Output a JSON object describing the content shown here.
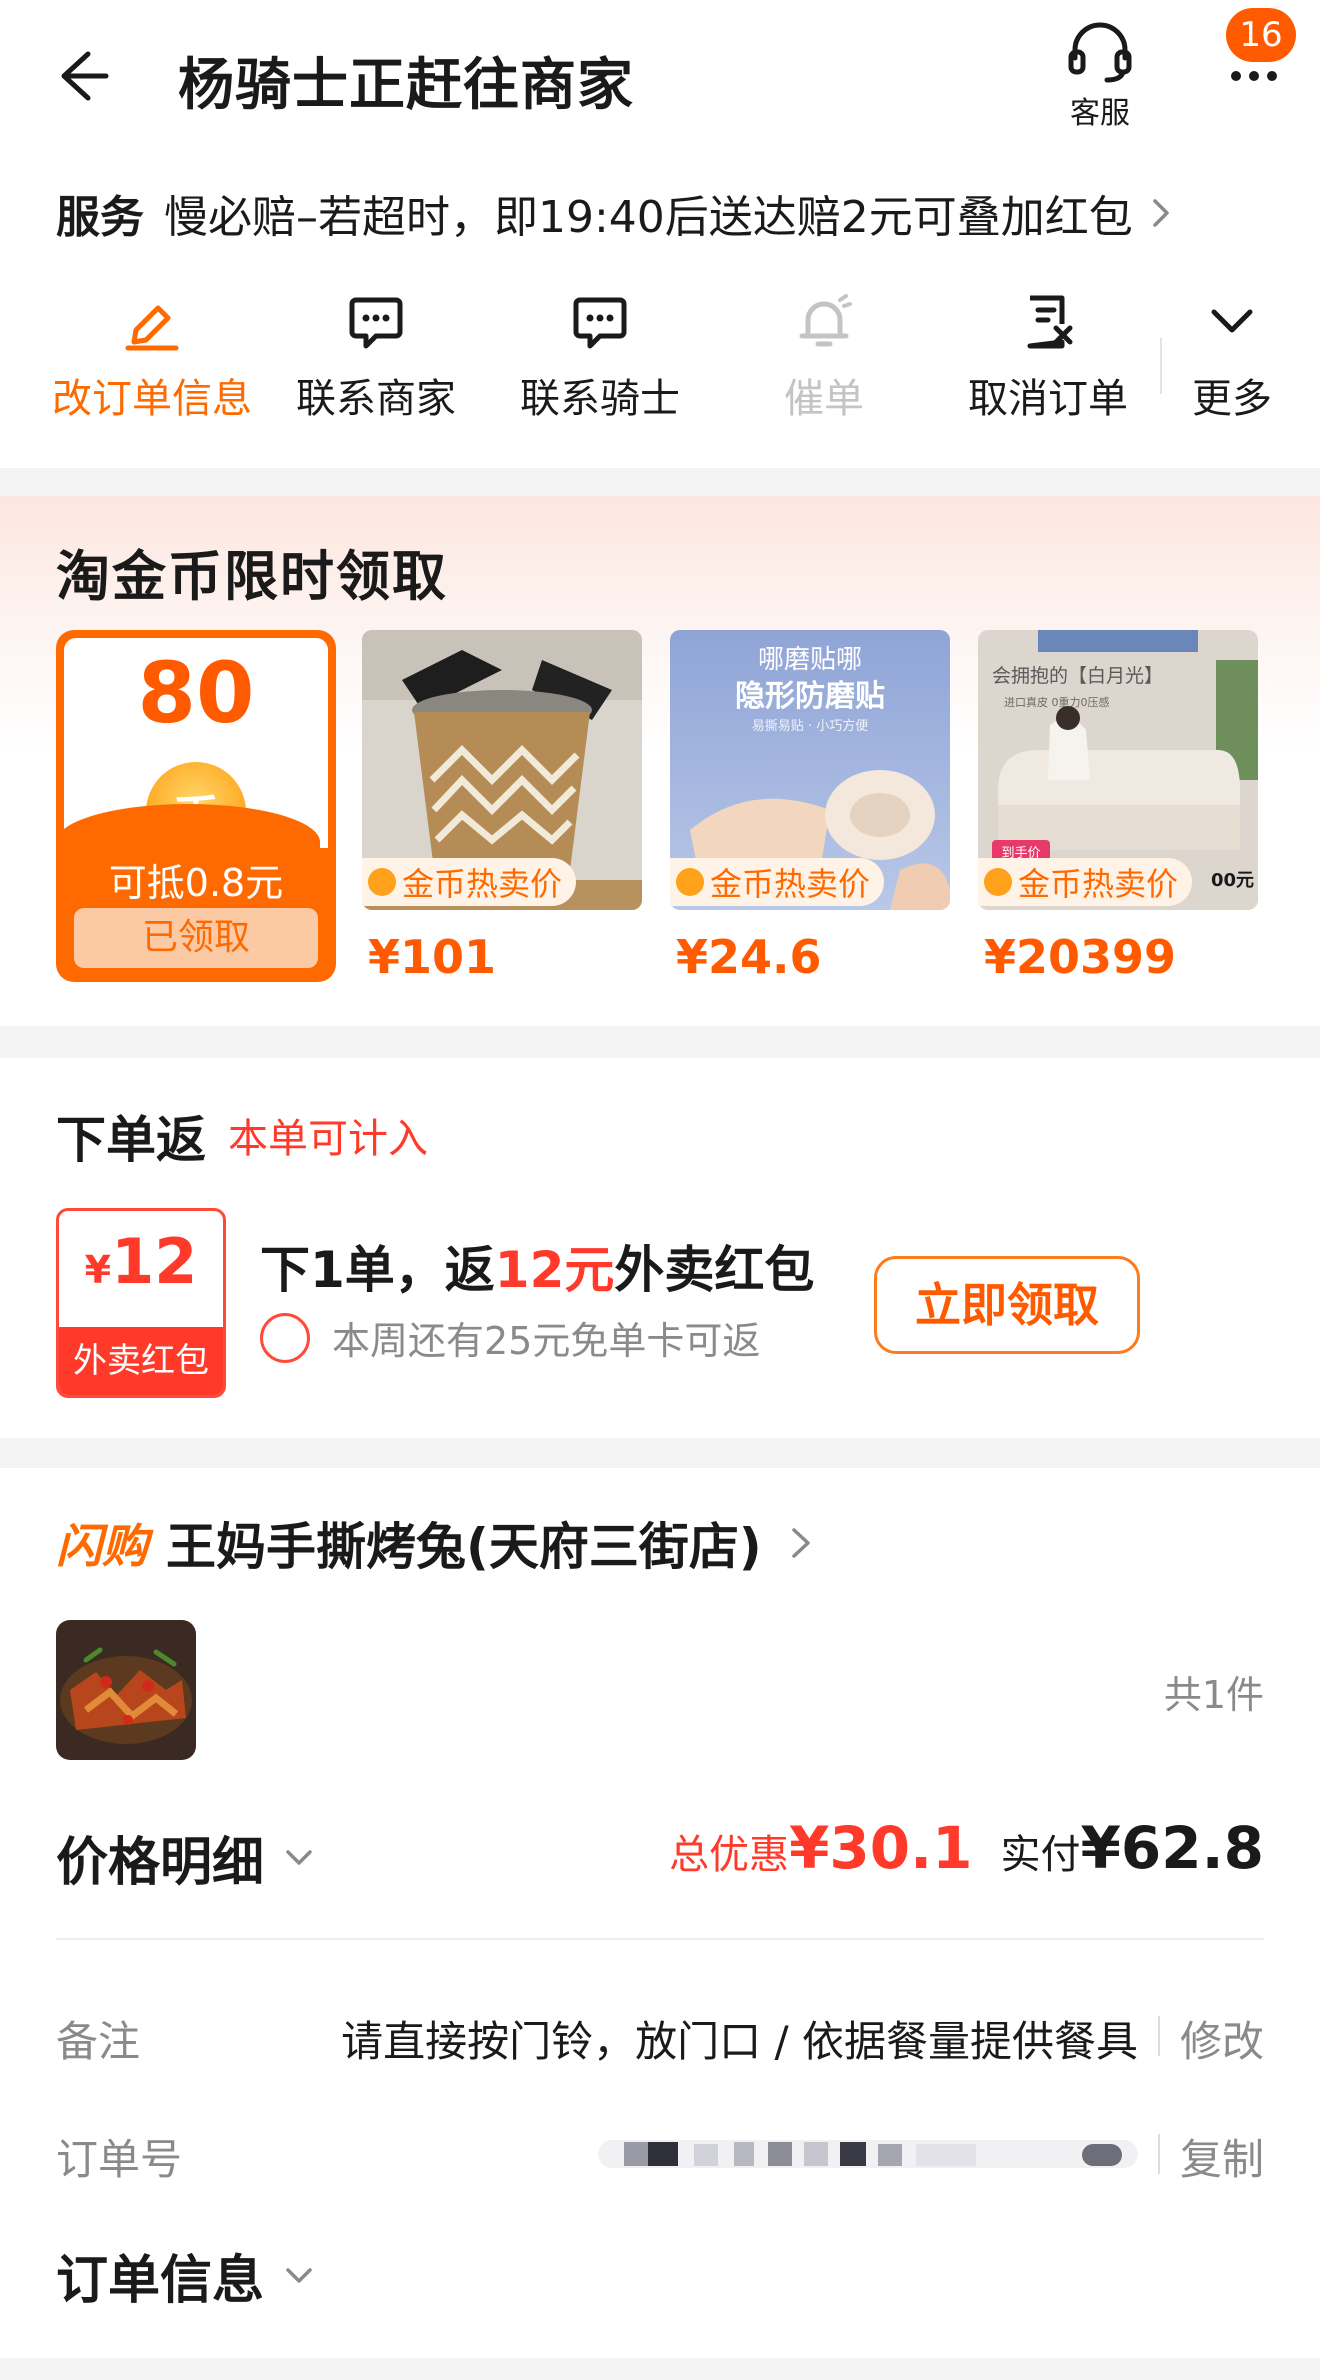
{
  "header": {
    "title": "杨骑士正赶往商家",
    "back_icon": "back-arrow-icon",
    "customer_service_label": "客服",
    "customer_service_icon": "headset-icon",
    "more_icon": "more-dots-icon",
    "message_badge": "16"
  },
  "service": {
    "label": "服务",
    "text": "慢必赔–若超时，即19:40后送达赔2元可叠加红包"
  },
  "actions": [
    {
      "label": "改订单信息",
      "icon": "edit-icon",
      "state": "active"
    },
    {
      "label": "联系商家",
      "icon": "chat-icon",
      "state": "normal"
    },
    {
      "label": "联系骑士",
      "icon": "chat-icon",
      "state": "normal"
    },
    {
      "label": "催单",
      "icon": "bell-icon",
      "state": "disabled"
    },
    {
      "label": "取消订单",
      "icon": "cancel-order-icon",
      "state": "normal"
    },
    {
      "label": "更多",
      "icon": "chevron-down-icon",
      "state": "normal"
    }
  ],
  "coins": {
    "title": "淘金币限时领取",
    "coupon": {
      "amount": "80",
      "coin_symbol": "币",
      "desc": "可抵0.8元",
      "button": "已领取"
    },
    "products": [
      {
        "tag": "金币热卖价",
        "price": "¥101"
      },
      {
        "tag": "金币热卖价",
        "price": "¥24.6",
        "img_text_1": "哪磨贴哪",
        "img_text_2": "隐形防磨贴",
        "img_text_3": "易撕易贴 · 小巧方便"
      },
      {
        "tag": "金币热卖价",
        "price": "¥20399",
        "img_text_1": "会拥抱的【白月光】",
        "img_text_2": "进口真皮  0重力0压感",
        "img_text_3": "到手价",
        "img_text_4": "00元"
      }
    ]
  },
  "cashback": {
    "title": "下单返",
    "subtitle": "本单可计入",
    "ticket_currency": "¥",
    "ticket_amount": "12",
    "ticket_label": "外卖红包",
    "line1_prefix": "下1单，返",
    "line1_highlight": "12元",
    "line1_suffix": "外卖红包",
    "line2": "本周还有25元免单卡可返",
    "claim_button": "立即领取"
  },
  "order": {
    "flash_logo": "闪购",
    "shop_name": "王妈手撕烤兔(天府三街店)",
    "item_count": "共1件",
    "price_detail_label": "价格明细",
    "discount_label": "总优惠",
    "discount_value": "¥30.1",
    "paid_label": "实付",
    "paid_value": "¥62.8",
    "note_label": "备注",
    "note_value": "请直接按门铃，放门口 / 依据餐量提供餐具",
    "note_action": "修改",
    "order_no_label": "订单号",
    "order_no_action": "复制",
    "order_info_label": "订单信息"
  },
  "colors": {
    "accent_orange": "#ff6a00",
    "accent_red": "#ff3a2a",
    "muted_text": "#8a8a8a"
  }
}
